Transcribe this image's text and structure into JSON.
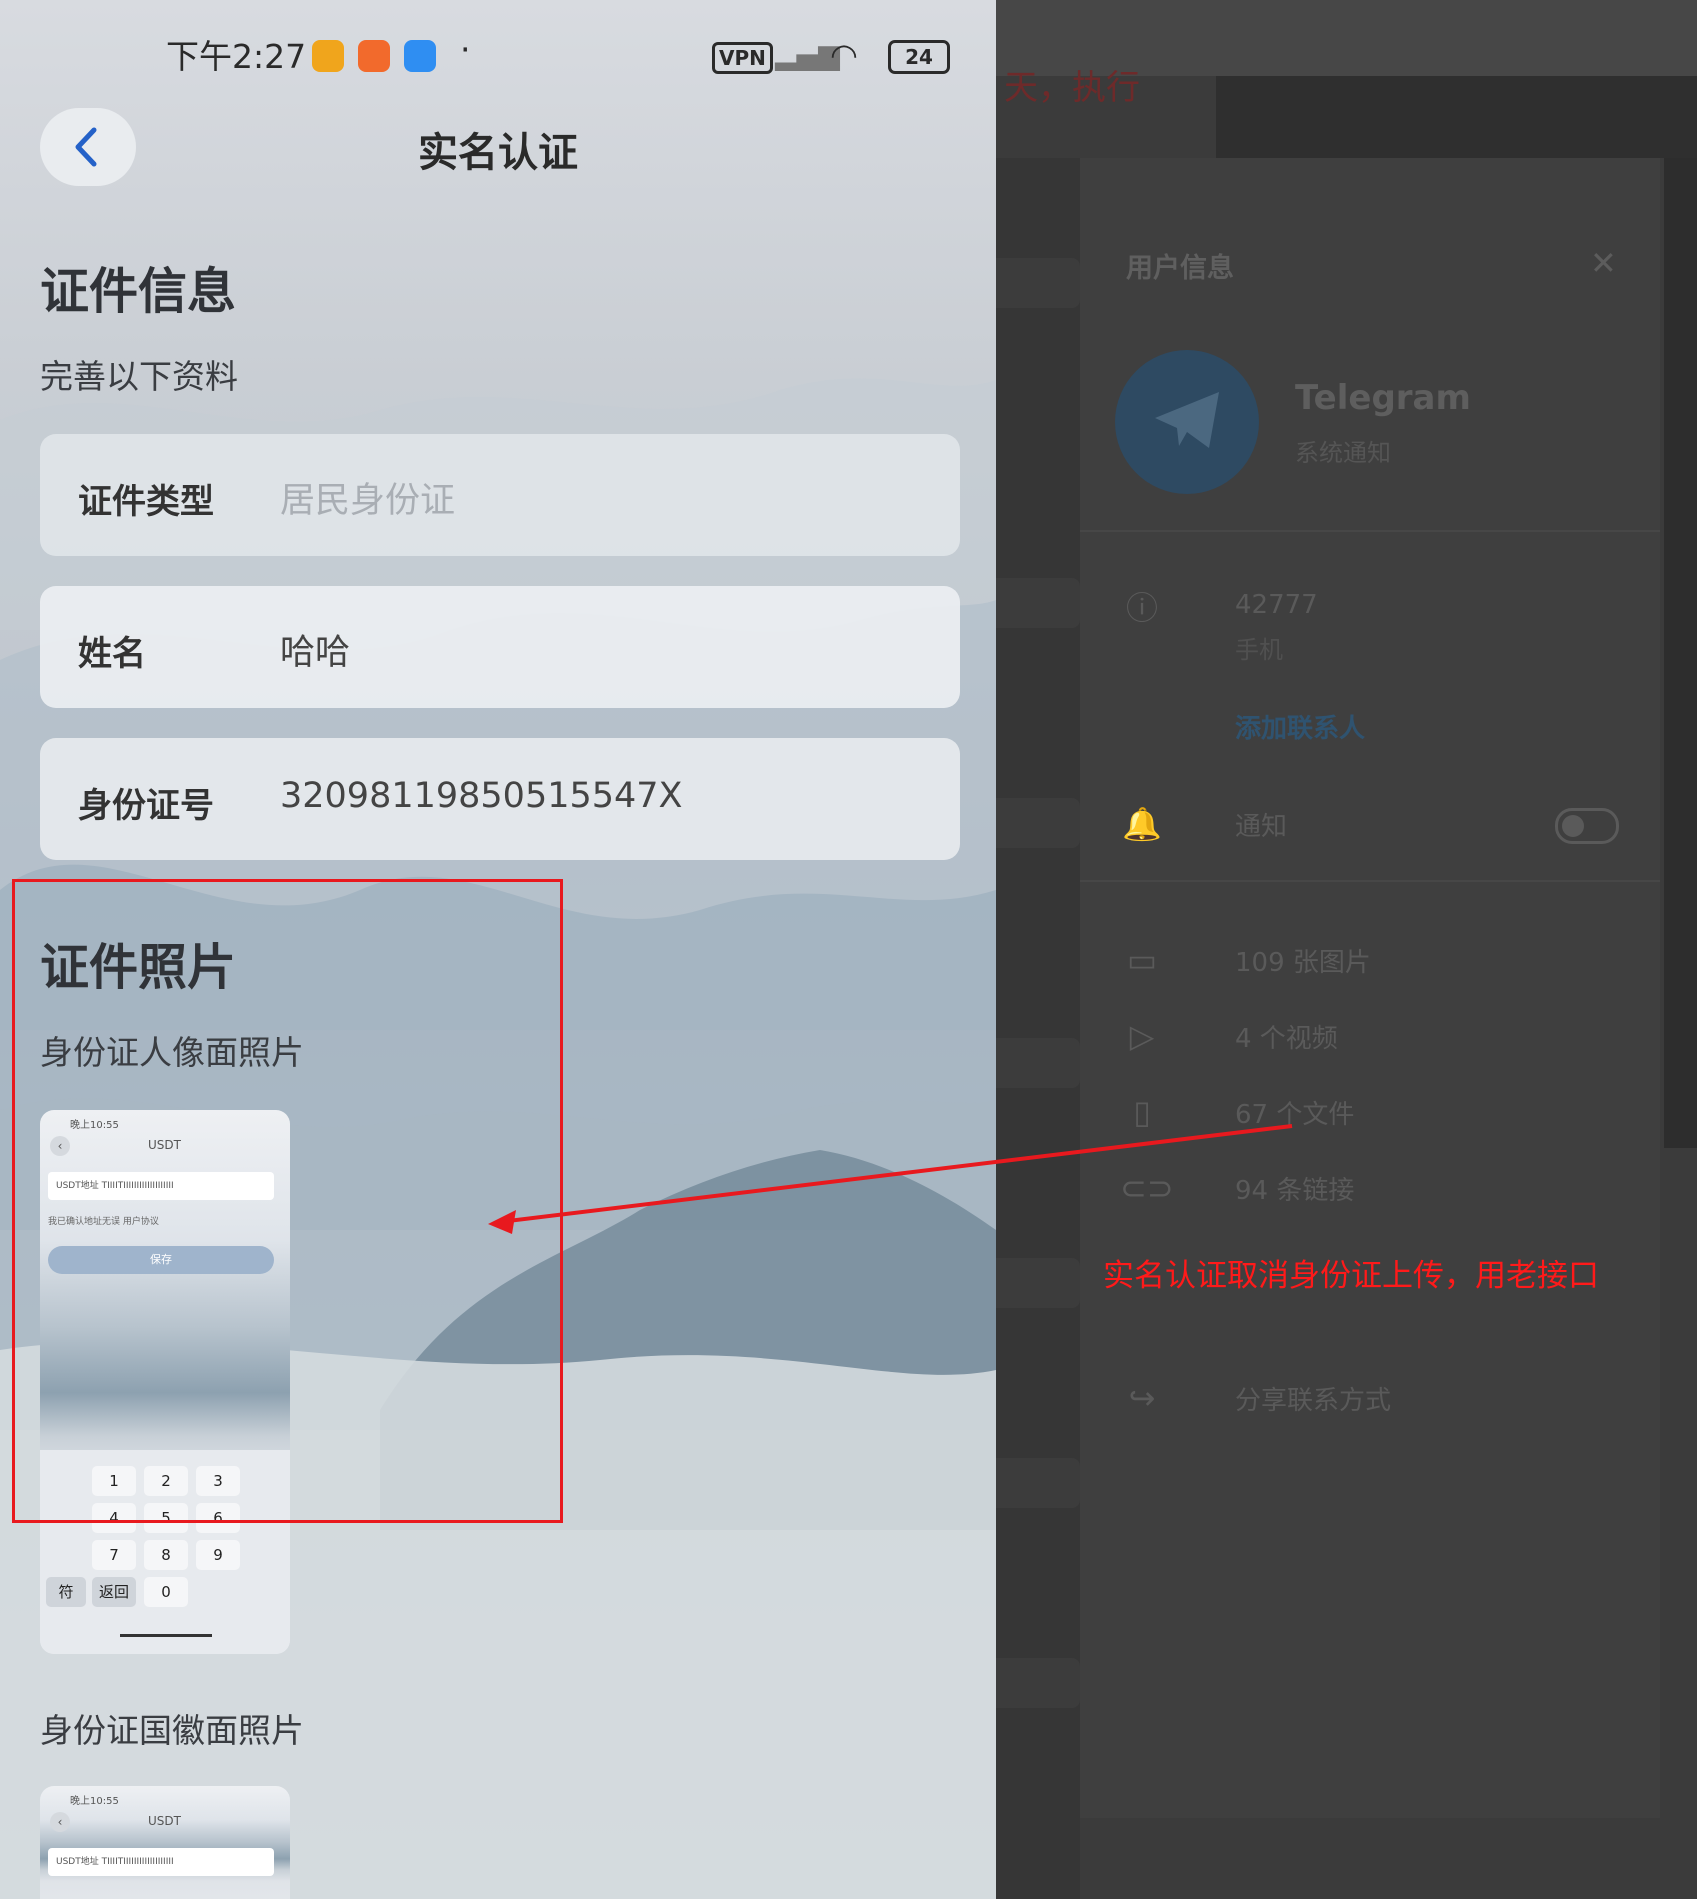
{
  "status_bar": {
    "time": "下午2:27",
    "vpn": "VPN",
    "battery": "24",
    "dot": "·"
  },
  "header": {
    "title": "实名认证"
  },
  "id_section": {
    "title": "证件信息",
    "subtitle": "完善以下资料",
    "fields": [
      {
        "label": "证件类型",
        "value": "居民身份证",
        "placeholder": true
      },
      {
        "label": "姓名",
        "value": "哈哈"
      },
      {
        "label": "身份证号",
        "value": "32098119850515547X"
      }
    ]
  },
  "photo_section": {
    "title": "证件照片",
    "front_label": "身份证人像面照片",
    "back_label": "身份证国徽面照片"
  },
  "thumbnail": {
    "time": "晚上10:55",
    "title": "USDT",
    "field_label": "USDT地址",
    "field_value": "TIIIITIIIIIIIIIIIIIIIIIII",
    "check_text": "我已确认地址无误 用户协议",
    "save": "保存",
    "keys": [
      "1",
      "2",
      "3",
      "4",
      "5",
      "6",
      "7",
      "8",
      "9",
      "0"
    ],
    "side_keys": [
      "符",
      "返回"
    ]
  },
  "telegram_panel": {
    "header": "用户信息",
    "name": "Telegram",
    "subtitle": "系统通知",
    "phone": "42777",
    "phone_label": "手机",
    "add_contact": "添加联系人",
    "notify": "通知",
    "photos": "109 张图片",
    "videos": "4 个视频",
    "files": "67 个文件",
    "links": "94 条链接",
    "share": "分享联系方式",
    "top_red_text": "天，执行"
  },
  "annotation": {
    "note": "实名认证取消身份证上传，用老接口",
    "color": "#e8191e"
  }
}
